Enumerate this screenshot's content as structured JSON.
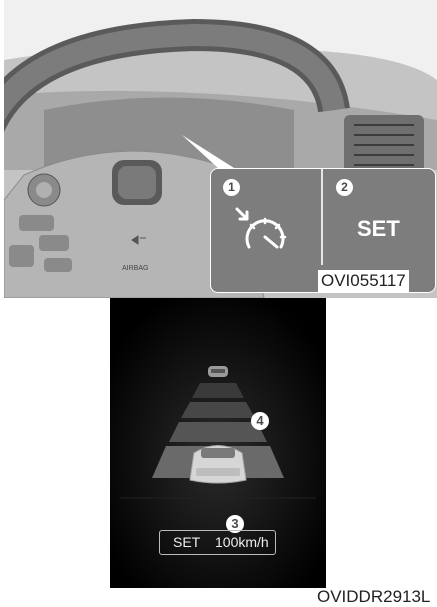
{
  "figure1": {
    "airbag_text": "AIRBAG",
    "callout": {
      "marker1": "1",
      "marker2": "2",
      "set_label": "SET",
      "cruise_icon": "cruise-control-icon"
    },
    "code": "OVI055117"
  },
  "figure2": {
    "marker3": "3",
    "marker4": "4",
    "set_text": "SET",
    "speed_text": "100km/h",
    "code": "OVIDDR2913L"
  }
}
